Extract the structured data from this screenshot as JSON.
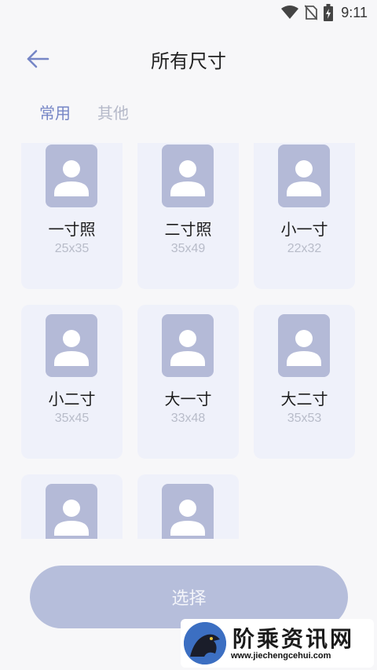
{
  "status_bar": {
    "time": "9:11",
    "icons": [
      "wifi-icon",
      "no-sim-icon",
      "battery-charging-icon"
    ]
  },
  "header": {
    "title": "所有尺寸",
    "back_icon": "arrow-left-icon"
  },
  "tabs": [
    {
      "label": "常用",
      "active": true
    },
    {
      "label": "其他",
      "active": false
    }
  ],
  "sizes": [
    {
      "name": "一寸照",
      "dims": "25x35"
    },
    {
      "name": "二寸照",
      "dims": "35x49"
    },
    {
      "name": "小一寸",
      "dims": "22x32"
    },
    {
      "name": "小二寸",
      "dims": "35x45"
    },
    {
      "name": "大一寸",
      "dims": "33x48"
    },
    {
      "name": "大二寸",
      "dims": "35x53"
    },
    {
      "name": "",
      "dims": ""
    },
    {
      "name": "",
      "dims": ""
    }
  ],
  "select_button": {
    "label": "选择"
  },
  "watermark": {
    "title": "阶乘资讯网",
    "url": "www.jiechengcehui.com"
  },
  "colors": {
    "accent": "#7686c6",
    "tab_inactive": "#b5b9c9",
    "card_bg": "#eff1fa",
    "avatar_bg": "#b4bad7",
    "button_bg": "#b6bedb"
  }
}
